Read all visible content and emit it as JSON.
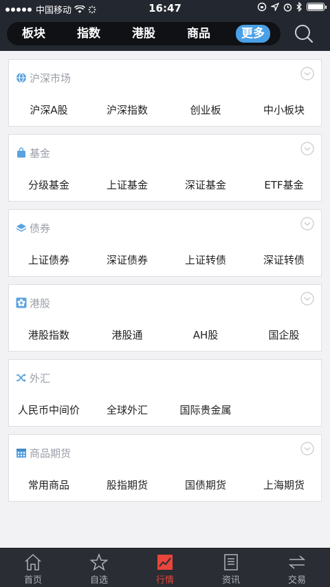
{
  "status_bar": {
    "carrier": "中国移动",
    "time": "16:47"
  },
  "header": {
    "tabs": [
      {
        "label": "板块",
        "active": false
      },
      {
        "label": "指数",
        "active": false
      },
      {
        "label": "港股",
        "active": false
      },
      {
        "label": "商品",
        "active": false
      },
      {
        "label": "更多",
        "active": true
      }
    ]
  },
  "sections": [
    {
      "title": "沪深市场",
      "icon": "globe-icon",
      "items": [
        "沪深A股",
        "沪深指数",
        "创业板",
        "中小板块"
      ]
    },
    {
      "title": "基金",
      "icon": "bag-icon",
      "items": [
        "分级基金",
        "上证基金",
        "深证基金",
        "ETF基金"
      ]
    },
    {
      "title": "债券",
      "icon": "layers-icon",
      "items": [
        "上证债券",
        "深证债券",
        "上证转债",
        "深证转债"
      ]
    },
    {
      "title": "港股",
      "icon": "flower-icon",
      "items": [
        "港股指数",
        "港股通",
        "AH股",
        "国企股"
      ]
    },
    {
      "title": "外汇",
      "icon": "shuffle-icon",
      "items": [
        "人民币中间价",
        "全球外汇",
        "国际贵金属"
      ]
    },
    {
      "title": "商品期货",
      "icon": "calendar-icon",
      "items": [
        "常用商品",
        "股指期货",
        "国债期货",
        "上海期货"
      ]
    }
  ],
  "bottom_nav": [
    {
      "label": "首页",
      "icon": "home-icon",
      "active": false
    },
    {
      "label": "自选",
      "icon": "star-icon",
      "active": false
    },
    {
      "label": "行情",
      "icon": "chart-icon",
      "active": true
    },
    {
      "label": "资讯",
      "icon": "news-icon",
      "active": false
    },
    {
      "label": "交易",
      "icon": "transfer-icon",
      "active": false
    }
  ],
  "colors": {
    "header_bg": "#23272f",
    "active_tab": "#4aa0e6",
    "icon_blue": "#5aa3e0",
    "active_nav": "#e8453c"
  }
}
